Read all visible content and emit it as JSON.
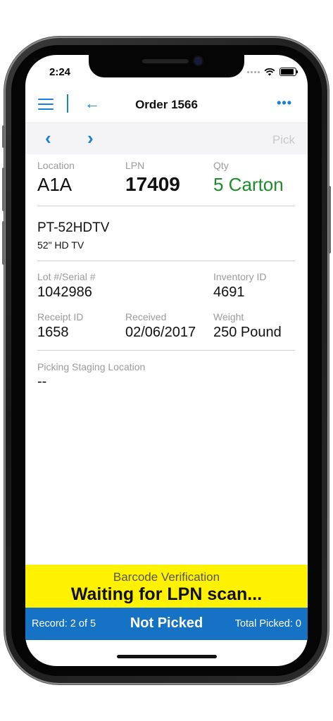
{
  "status_bar": {
    "time": "2:24"
  },
  "nav": {
    "title": "Order 1566"
  },
  "toolbar": {
    "pick_label": "Pick"
  },
  "item": {
    "location_label": "Location",
    "location_value": "A1A",
    "lpn_label": "LPN",
    "lpn_value": "17409",
    "qty_label": "Qty",
    "qty_value": "5 Carton",
    "product_code": "PT-52HDTV",
    "product_desc": "52\" HD TV",
    "lot_label": "Lot #/Serial #",
    "lot_value": "1042986",
    "inventory_label": "Inventory ID",
    "inventory_value": "4691",
    "receipt_label": "Receipt ID",
    "receipt_value": "1658",
    "received_label": "Received",
    "received_value": "02/06/2017",
    "weight_label": "Weight",
    "weight_value": "250 Pound",
    "staging_label": "Picking Staging Location",
    "staging_value": "--"
  },
  "barcode": {
    "title": "Barcode Verification",
    "status": "Waiting for LPN scan..."
  },
  "footer": {
    "record": "Record: 2 of 5",
    "status": "Not Picked",
    "total": "Total Picked: 0"
  },
  "colors": {
    "accent": "#1a7fd6",
    "qty_green": "#1e8c2a",
    "banner_yellow": "#fff200",
    "footer_blue": "#1672c4"
  },
  "icons": [
    "menu-icon",
    "back-arrow-icon",
    "more-icon",
    "chevron-left-icon",
    "chevron-right-icon",
    "wifi-icon",
    "battery-icon",
    "signal-icon"
  ]
}
